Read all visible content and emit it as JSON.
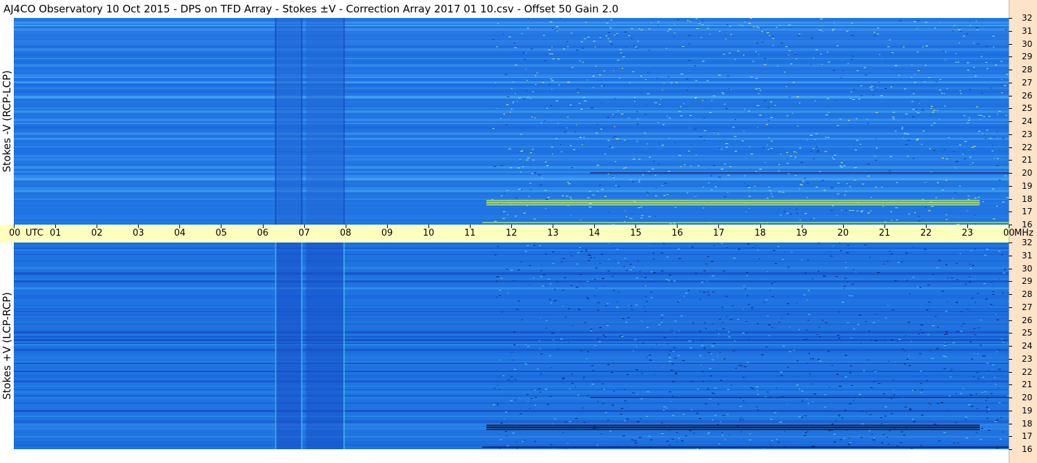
{
  "title": "AJ4CO Observatory  10 Oct 2015  -  DPS on TFD Array  -  Stokes ±V  -  Correction Array 2017 01 10.csv  -  Offset 50  Gain 2.0",
  "colors": {
    "background_field": "#1e74e2",
    "time_axis_bg": "#ffffc0",
    "right_pad_bg": "#fde3c8"
  },
  "chart_data": [
    {
      "type": "heatmap",
      "ylabel": "Stokes -V (RCP-LCP)",
      "xlabel": "UTC",
      "x_tick_labels": [
        "00",
        "01",
        "02",
        "03",
        "04",
        "05",
        "06",
        "07",
        "08",
        "09",
        "10",
        "11",
        "12",
        "13",
        "14",
        "15",
        "16",
        "17",
        "18",
        "19",
        "20",
        "21",
        "22",
        "23",
        "00"
      ],
      "x_range_hours": [
        0,
        24
      ],
      "y_unit": "MHz",
      "y_tick_labels": [
        "16",
        "17",
        "18",
        "19",
        "20",
        "21",
        "22",
        "23",
        "24",
        "25",
        "26",
        "27",
        "28",
        "29",
        "30",
        "31",
        "32"
      ],
      "ylim_mhz": [
        16,
        32
      ]
    },
    {
      "type": "heatmap",
      "ylabel": "Stokes +V (LCP-RCP)",
      "xlabel": "UTC",
      "x_tick_labels": [
        "00",
        "01",
        "02",
        "03",
        "04",
        "05",
        "06",
        "07",
        "08",
        "09",
        "10",
        "11",
        "12",
        "13",
        "14",
        "15",
        "16",
        "17",
        "18",
        "19",
        "20",
        "21",
        "22",
        "23",
        "00"
      ],
      "x_range_hours": [
        0,
        24
      ],
      "y_unit": "MHz",
      "y_tick_labels": [
        "16",
        "17",
        "18",
        "19",
        "20",
        "21",
        "22",
        "23",
        "24",
        "25",
        "26",
        "27",
        "28",
        "29",
        "30",
        "31",
        "32"
      ],
      "ylim_mhz": [
        16,
        32
      ]
    }
  ],
  "axis": {
    "utc_label": "UTC",
    "mhz_label": "MHz"
  }
}
